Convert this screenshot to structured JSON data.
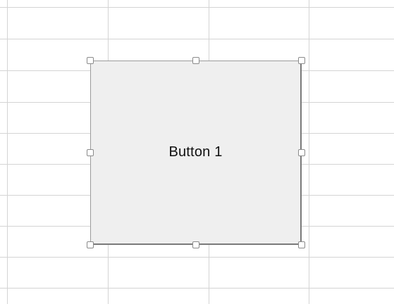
{
  "button": {
    "label": "Button 1",
    "face_color": "#efefef",
    "border_color": "#9b9b9b"
  },
  "sheet": {
    "gridline_color": "#d4d4d4"
  },
  "selection_handles": [
    "top-left",
    "top-middle",
    "top-right",
    "middle-left",
    "middle-right",
    "bottom-left",
    "bottom-middle",
    "bottom-right"
  ]
}
